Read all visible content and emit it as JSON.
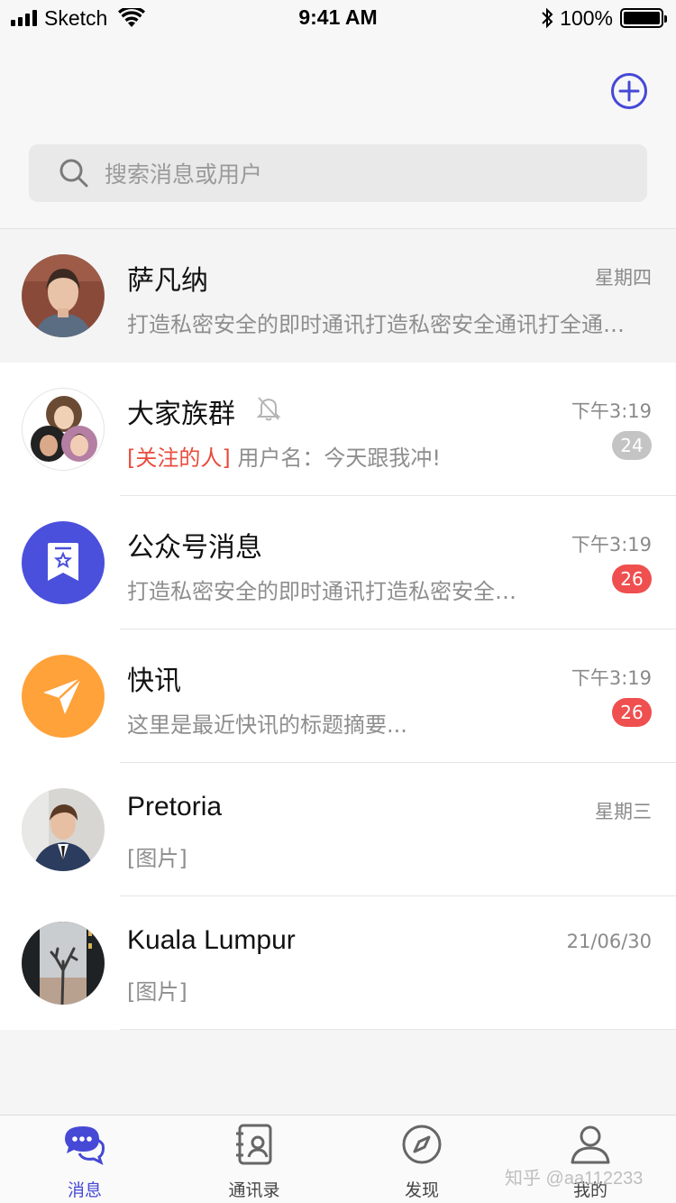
{
  "status_bar": {
    "carrier": "Sketch",
    "time": "9:41 AM",
    "battery_percent": "100%",
    "battery_level": 1.0,
    "icons": [
      "signal-icon",
      "wifi-icon",
      "bluetooth-icon",
      "battery-icon"
    ]
  },
  "header": {
    "add_icon": "plus-circle-icon"
  },
  "search": {
    "placeholder": "搜索消息或用户"
  },
  "colors": {
    "accent": "#4648d6",
    "badge_red": "#ef4f4f",
    "badge_gray": "#c4c4c4",
    "mention_red": "#e84c3d",
    "official_bg": "#4a4fdc",
    "news_bg": "#ffa23a"
  },
  "chats": [
    {
      "name": "萨凡纳",
      "time": "星期四",
      "preview": "打造私密安全的即时通讯打造私密安全通讯打全通讯…",
      "pinned": true
    },
    {
      "name": "大家族群",
      "time": "下午3:19",
      "mention": "[关注的人]",
      "preview": "用户名：今天跟我冲!",
      "badge": "24",
      "muted": true
    },
    {
      "name": "公众号消息",
      "time": "下午3:19",
      "preview": "打造私密安全的即时通讯打造私密安全…",
      "badge": "26"
    },
    {
      "name": "快讯",
      "time": "下午3:19",
      "preview": "这里是最近快讯的标题摘要...",
      "badge": "26"
    },
    {
      "name": "Pretoria",
      "time": "星期三",
      "preview": "[图片]"
    },
    {
      "name": "Kuala Lumpur",
      "time": "21/06/30",
      "preview": "[图片]"
    }
  ],
  "tabs": [
    {
      "label": "消息",
      "icon": "chat-bubble-icon",
      "active": true
    },
    {
      "label": "通讯录",
      "icon": "contacts-book-icon",
      "active": false
    },
    {
      "label": "发现",
      "icon": "compass-icon",
      "active": false
    },
    {
      "label": "我的",
      "icon": "user-icon",
      "active": false
    }
  ],
  "watermark": "知乎 @aa112233"
}
